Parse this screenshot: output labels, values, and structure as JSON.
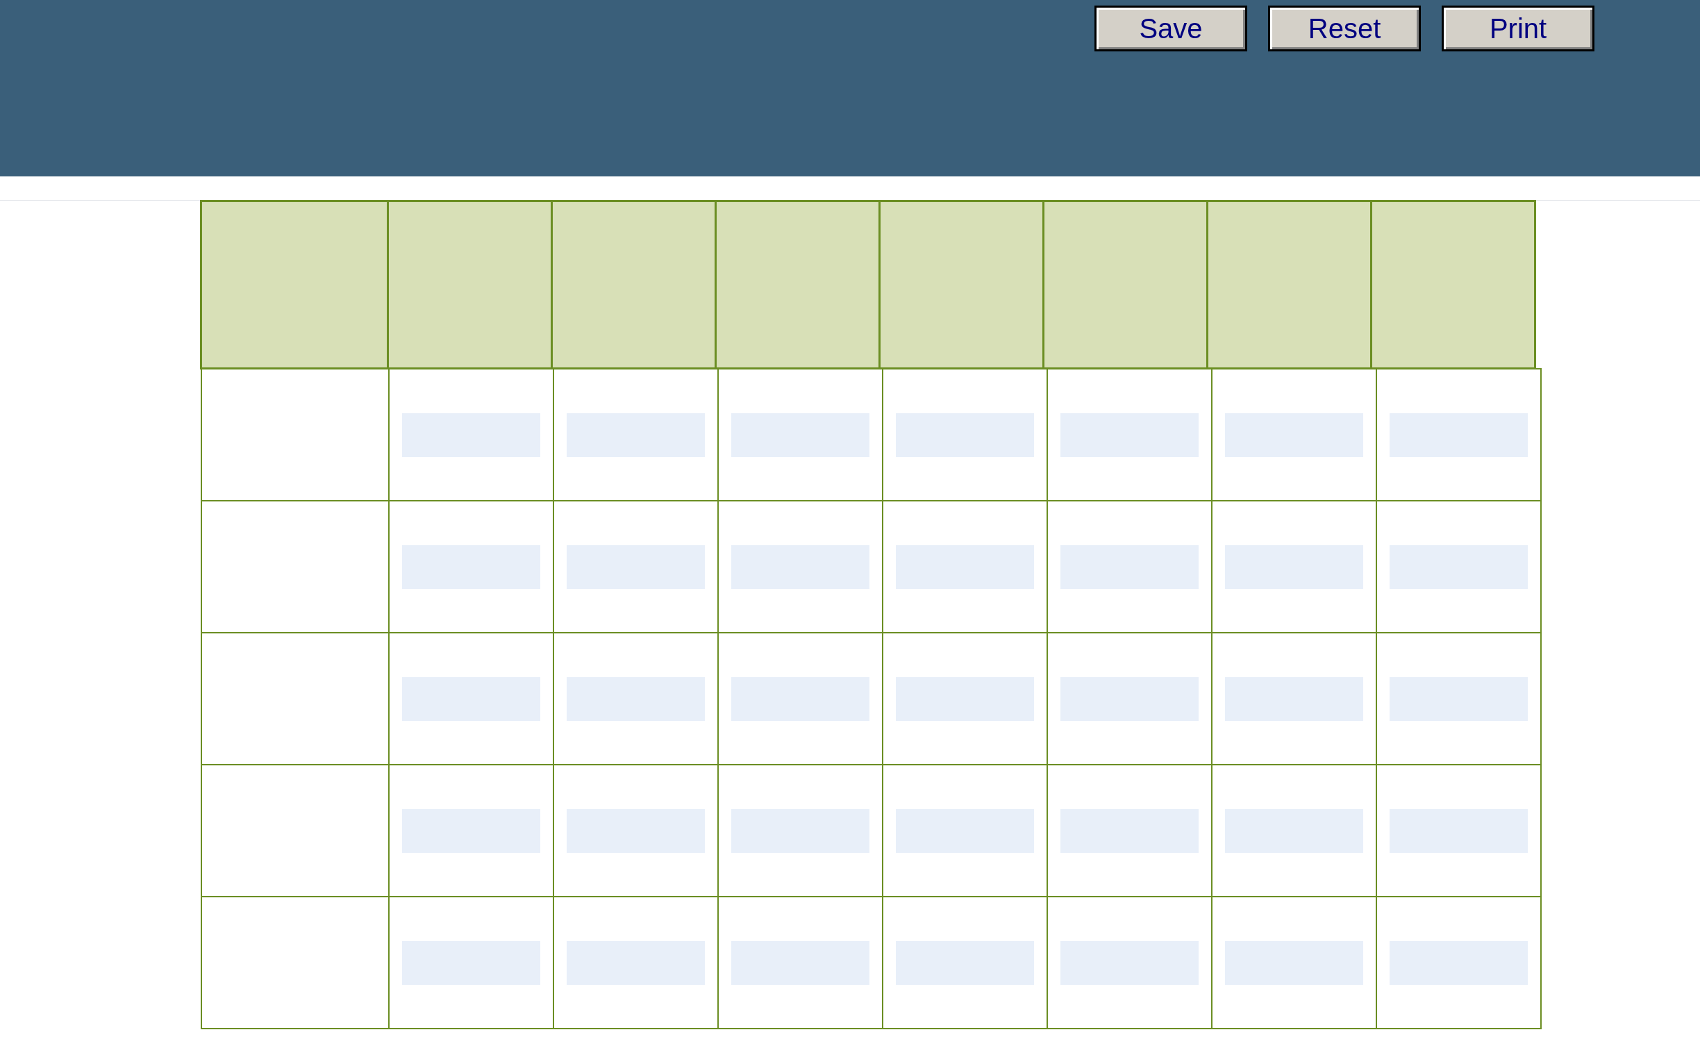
{
  "toolbar": {
    "buttons": [
      "Save",
      "Reset",
      "Print"
    ]
  },
  "table": {
    "header": [
      {
        "kind": "blank"
      },
      {
        "kind": "blank"
      },
      {
        "kind": "blank"
      },
      {
        "kind": "blank"
      },
      {
        "kind": "blank"
      },
      {
        "kind": "blank"
      },
      {
        "kind": "blank"
      },
      {
        "kind": "blank"
      }
    ],
    "rows": [
      {
        "cells": [
          {
            "kind": "blank"
          },
          {
            "kind": "input"
          },
          {
            "kind": "input"
          },
          {
            "kind": "input"
          },
          {
            "kind": "input"
          },
          {
            "kind": "input"
          },
          {
            "kind": "input"
          },
          {
            "kind": "input"
          }
        ]
      },
      {
        "cells": [
          {
            "kind": "blank"
          },
          {
            "kind": "input"
          },
          {
            "kind": "input"
          },
          {
            "kind": "input"
          },
          {
            "kind": "input"
          },
          {
            "kind": "input"
          },
          {
            "kind": "input"
          },
          {
            "kind": "input"
          }
        ]
      },
      {
        "cells": [
          {
            "kind": "blank"
          },
          {
            "kind": "input"
          },
          {
            "kind": "input"
          },
          {
            "kind": "input"
          },
          {
            "kind": "input"
          },
          {
            "kind": "input"
          },
          {
            "kind": "input"
          },
          {
            "kind": "input"
          }
        ]
      },
      {
        "cells": [
          {
            "kind": "blank"
          },
          {
            "kind": "input"
          },
          {
            "kind": "input"
          },
          {
            "kind": "input"
          },
          {
            "kind": "input"
          },
          {
            "kind": "input"
          },
          {
            "kind": "input"
          },
          {
            "kind": "input"
          }
        ]
      },
      {
        "cells": [
          {
            "kind": "blank"
          },
          {
            "kind": "input"
          },
          {
            "kind": "input"
          },
          {
            "kind": "input"
          },
          {
            "kind": "input"
          },
          {
            "kind": "input"
          },
          {
            "kind": "input"
          },
          {
            "kind": "input"
          }
        ]
      }
    ]
  }
}
